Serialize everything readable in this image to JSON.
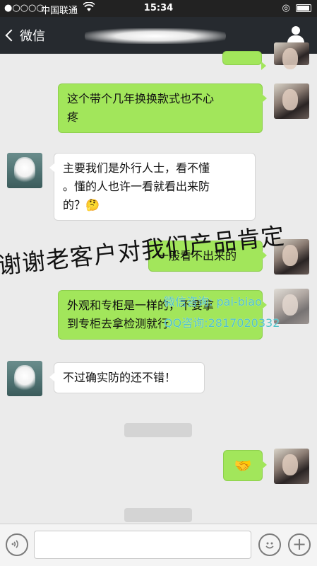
{
  "status_bar": {
    "signal": "●○○○○",
    "carrier": "中国联通",
    "wifi_icon": "wifi-icon",
    "time": "15:34",
    "battery_icon": "battery-icon"
  },
  "nav": {
    "back_label": "微信",
    "title_blurred": true,
    "contact_icon": "person-icon"
  },
  "messages": [
    {
      "side": "right",
      "text": "这个带个几年换换款式也不心\n疼"
    },
    {
      "side": "left",
      "text": "主要我们是外行人士，看不懂\n。懂的人也许一看就看出来防\n的？🤔"
    },
    {
      "side": "right",
      "text": "一般看不出来的"
    },
    {
      "side": "right",
      "text": "外观和专柜是一样的，不要拿\n到专柜去拿检测就行"
    },
    {
      "side": "left",
      "text": "不过确实防的还不错！"
    },
    {
      "side": "right",
      "text": "🤝"
    }
  ],
  "overlay": {
    "text": "谢谢老客户对我们产品肯定"
  },
  "watermark": {
    "line1": "微信咨询: pai-biao",
    "line2": "QQ咨询:2817020332"
  },
  "input_bar": {
    "voice_icon": "voice-icon",
    "emoji_icon": "emoji-icon",
    "plus_icon": "plus-icon",
    "input_value": ""
  }
}
